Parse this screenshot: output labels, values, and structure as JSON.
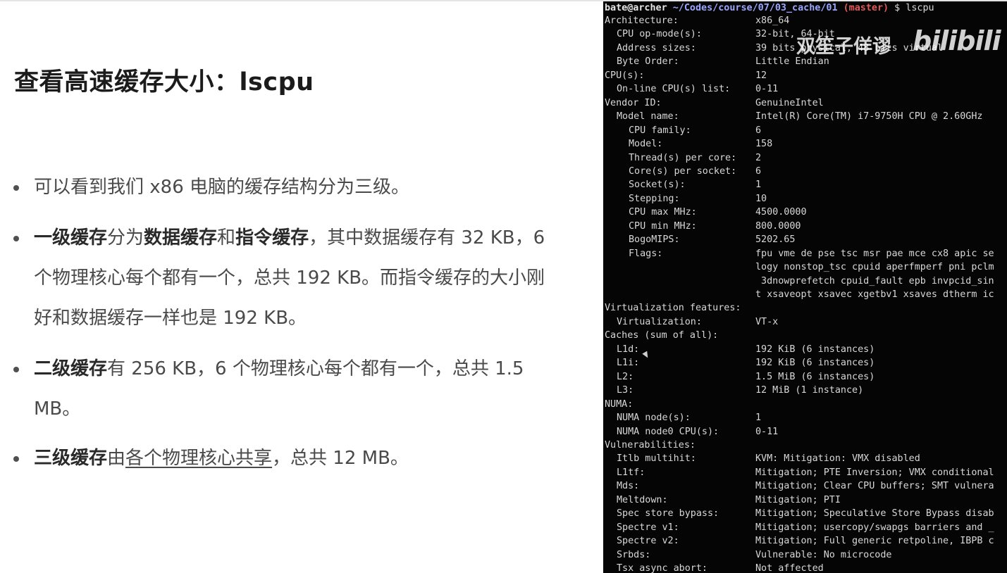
{
  "slide": {
    "title": "查看高速缓存大小：lscpu",
    "bullets": [
      [
        {
          "t": "可以看到我们 x86 电脑的缓存结构分为三级。"
        }
      ],
      [
        {
          "t": "一级缓存",
          "b": true
        },
        {
          "t": "分为"
        },
        {
          "t": "数据缓存",
          "b": true
        },
        {
          "t": "和"
        },
        {
          "t": "指令缓存",
          "b": true
        },
        {
          "t": "，其中数据缓存有 32 KB，6 个物理核心每个都有一个，总共 192 KB。而指令缓存的大小刚好和数据缓存一样也是 192 KB。"
        }
      ],
      [
        {
          "t": "二级缓存",
          "b": true
        },
        {
          "t": "有 256 KB，6 个物理核心每个都有一个，总共 1.5 MB。"
        }
      ],
      [
        {
          "t": "三级缓存",
          "b": true
        },
        {
          "t": "由"
        },
        {
          "t": "各个物理核心共享",
          "u": true
        },
        {
          "t": "，总共 12 MB。"
        }
      ]
    ]
  },
  "terminal": {
    "prompt": {
      "user": "bate@archer",
      "path": "~/Codes/course/07/03_cache/01",
      "branch": "(master)",
      "cmd": "$ lscpu"
    },
    "lines": [
      {
        "k": "Architecture:",
        "v": "x86_64",
        "i": 0
      },
      {
        "k": "CPU op-mode(s):",
        "v": "32-bit, 64-bit",
        "i": 1
      },
      {
        "k": "Address sizes:",
        "v": "39 bits physical, 48 bits virtual",
        "i": 1
      },
      {
        "k": "Byte Order:",
        "v": "Little Endian",
        "i": 1
      },
      {
        "k": "CPU(s):",
        "v": "12",
        "i": 0
      },
      {
        "k": "On-line CPU(s) list:",
        "v": "0-11",
        "i": 1
      },
      {
        "k": "Vendor ID:",
        "v": "GenuineIntel",
        "i": 0
      },
      {
        "k": "Model name:",
        "v": "Intel(R) Core(TM) i7-9750H CPU @ 2.60GHz",
        "i": 1
      },
      {
        "k": "CPU family:",
        "v": "6",
        "i": 2
      },
      {
        "k": "Model:",
        "v": "158",
        "i": 2
      },
      {
        "k": "Thread(s) per core:",
        "v": "2",
        "i": 2
      },
      {
        "k": "Core(s) per socket:",
        "v": "6",
        "i": 2
      },
      {
        "k": "Socket(s):",
        "v": "1",
        "i": 2
      },
      {
        "k": "Stepping:",
        "v": "10",
        "i": 2
      },
      {
        "k": "CPU max MHz:",
        "v": "4500.0000",
        "i": 2
      },
      {
        "k": "CPU min MHz:",
        "v": "800.0000",
        "i": 2
      },
      {
        "k": "BogoMIPS:",
        "v": "5202.65",
        "i": 2
      },
      {
        "k": "Flags:",
        "v": "fpu vme de pse tsc msr pae mce cx8 apic se",
        "i": 2
      },
      {
        "k": "",
        "v": "logy nonstop_tsc cpuid aperfmperf pni pclm",
        "i": 2
      },
      {
        "k": "",
        "v": " 3dnowprefetch cpuid_fault epb invpcid_sin",
        "i": 2
      },
      {
        "k": "",
        "v": "t xsaveopt xsavec xgetbv1 xsaves dtherm ic",
        "i": 2
      },
      {
        "k": "Virtualization features:",
        "v": "",
        "i": 0
      },
      {
        "k": "Virtualization:",
        "v": "VT-x",
        "i": 1
      },
      {
        "k": "Caches (sum of all):",
        "v": "",
        "i": 0
      },
      {
        "k": "L1d:",
        "v": "192 KiB (6 instances)",
        "i": 1
      },
      {
        "k": "L1i:",
        "v": "192 KiB (6 instances)",
        "i": 1
      },
      {
        "k": "L2:",
        "v": "1.5 MiB (6 instances)",
        "i": 1
      },
      {
        "k": "L3:",
        "v": "12 MiB (1 instance)",
        "i": 1
      },
      {
        "k": "NUMA:",
        "v": "",
        "i": 0
      },
      {
        "k": "NUMA node(s):",
        "v": "1",
        "i": 1
      },
      {
        "k": "NUMA node0 CPU(s):",
        "v": "0-11",
        "i": 1
      },
      {
        "k": "Vulnerabilities:",
        "v": "",
        "i": 0
      },
      {
        "k": "Itlb multihit:",
        "v": "KVM: Mitigation: VMX disabled",
        "i": 1
      },
      {
        "k": "L1tf:",
        "v": "Mitigation; PTE Inversion; VMX conditional",
        "i": 1
      },
      {
        "k": "Mds:",
        "v": "Mitigation; Clear CPU buffers; SMT vulnera",
        "i": 1
      },
      {
        "k": "Meltdown:",
        "v": "Mitigation; PTI",
        "i": 1
      },
      {
        "k": "Spec store bypass:",
        "v": "Mitigation; Speculative Store Bypass disab",
        "i": 1
      },
      {
        "k": "Spectre v1:",
        "v": "Mitigation; usercopy/swapgs barriers and _",
        "i": 1
      },
      {
        "k": "Spectre v2:",
        "v": "Mitigation; Full generic retpoline, IBPB c",
        "i": 1
      },
      {
        "k": "Srbds:",
        "v": "Vulnerable: No microcode",
        "i": 1
      },
      {
        "k": "Tsx async abort:",
        "v": "Not affected",
        "i": 1
      }
    ]
  },
  "watermark": {
    "text": "双笙子佯谬",
    "logo": "bilibili"
  }
}
